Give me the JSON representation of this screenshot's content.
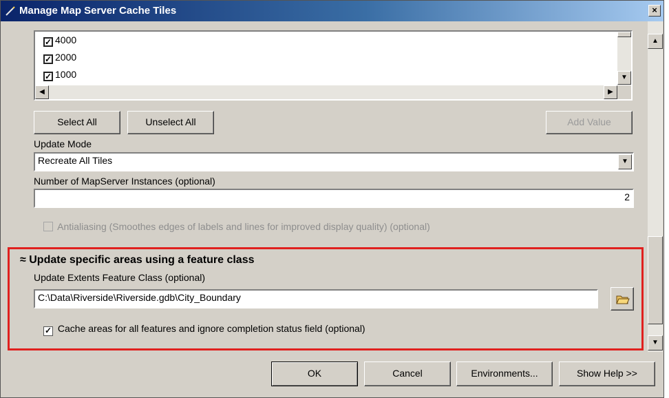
{
  "window": {
    "title": "Manage Map Server Cache Tiles",
    "close_label": "×"
  },
  "scales": [
    {
      "label": "4000",
      "checked": true
    },
    {
      "label": "2000",
      "checked": true
    },
    {
      "label": "1000",
      "checked": true
    }
  ],
  "buttons": {
    "select_all": "Select All",
    "unselect_all": "Unselect All",
    "add_value": "Add Value"
  },
  "update_mode": {
    "label": "Update Mode",
    "value": "Recreate All Tiles"
  },
  "instances": {
    "label": "Number of MapServer Instances (optional)",
    "value": "2"
  },
  "antialiasing": {
    "label": "Antialiasing (Smoothes edges of labels and lines for improved display quality) (optional)",
    "checked": false,
    "enabled": false
  },
  "section": {
    "toggle": "≈",
    "title": "Update specific areas using a feature class"
  },
  "extents": {
    "label": "Update Extents Feature Class (optional)",
    "value": "C:\\Data\\Riverside\\Riverside.gdb\\City_Boundary"
  },
  "cache_all": {
    "label": "Cache areas for all features and ignore completion status field (optional)",
    "checked": true
  },
  "footer": {
    "ok": "OK",
    "cancel": "Cancel",
    "environments": "Environments...",
    "show_help": "Show Help >>"
  },
  "icons": {
    "title": "wand-icon",
    "browse": "open-folder-icon"
  },
  "colors": {
    "highlight": "#e0201e",
    "titlebar": "#0a246a"
  }
}
